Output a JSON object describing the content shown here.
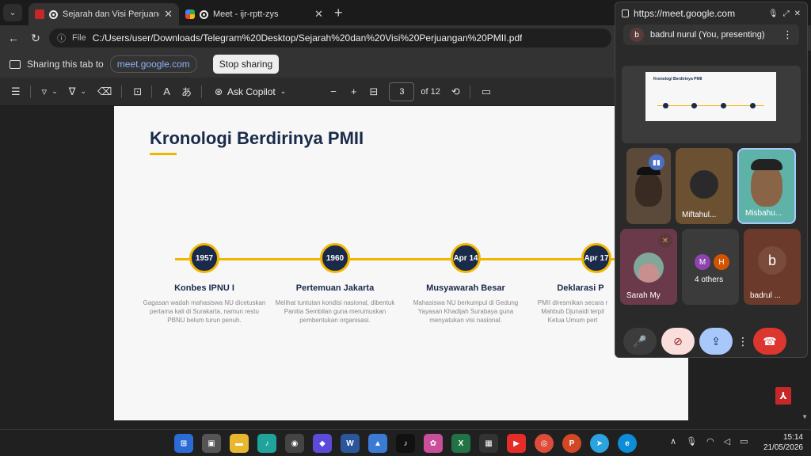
{
  "browser": {
    "tabs": [
      {
        "title": "Sejarah dan Visi Perjuangan PMII.pdf",
        "active": true
      },
      {
        "title": "Meet - ijr-rptt-zys",
        "active": false
      }
    ],
    "address": {
      "label": "File",
      "url": "C:/Users/user/Downloads/Telegram%20Desktop/Sejarah%20dan%20Visi%20Perjuangan%20PMII.pdf"
    }
  },
  "sharing": {
    "text": "Sharing this tab to",
    "target": "meet.google.com",
    "stop_label": "Stop sharing"
  },
  "pdf_toolbar": {
    "copilot_label": "Ask Copilot",
    "page_number": "3",
    "page_count": "of 12"
  },
  "slide": {
    "title": "Kronologi Berdirinya PMII",
    "milestones": [
      {
        "date": "1957",
        "title": "Konbes IPNU I",
        "desc": "Gagasan wadah mahasiswa NU dicetuskan pertama kali di Surakarta, namun restu PBNU belum turun penuh."
      },
      {
        "date": "1960",
        "title": "Pertemuan Jakarta",
        "desc": "Melihat tuntutan kondisi nasional, dibentuk Panitia Sembilan guna merumuskan pembentukan organisasi."
      },
      {
        "date": "Apr 14",
        "title": "Musyawarah Besar",
        "desc": "Mahasiswa NU berkumpul di Gedung Yayasan Khadijah Surabaya guna menyatukan visi nasional."
      },
      {
        "date": "Apr 17",
        "title": "Deklarasi P",
        "desc": "PMII diresmikan secara r Mahbub Djunaidi terpil Ketua Umum pert"
      }
    ]
  },
  "meet": {
    "url": "https://meet.google.com",
    "presenter": {
      "initial": "b",
      "label": "badrul nurul (You, presenting)"
    },
    "preview_title": "Kronologi Berdirinya PMII",
    "participants": [
      {
        "name": ""
      },
      {
        "name": "Miftahul..."
      },
      {
        "name": "Misbahu..."
      },
      {
        "name": "Sarah My"
      },
      {
        "name": "4 others",
        "initials": [
          "M",
          "H"
        ]
      },
      {
        "name": "badrul ...",
        "initial": "b"
      }
    ]
  },
  "taskbar": {
    "time": "15:14",
    "date": "21/05/2026"
  },
  "colors": {
    "accent_gold": "#f2b600",
    "navy": "#1a2a4a",
    "end_call": "#dc362e"
  }
}
